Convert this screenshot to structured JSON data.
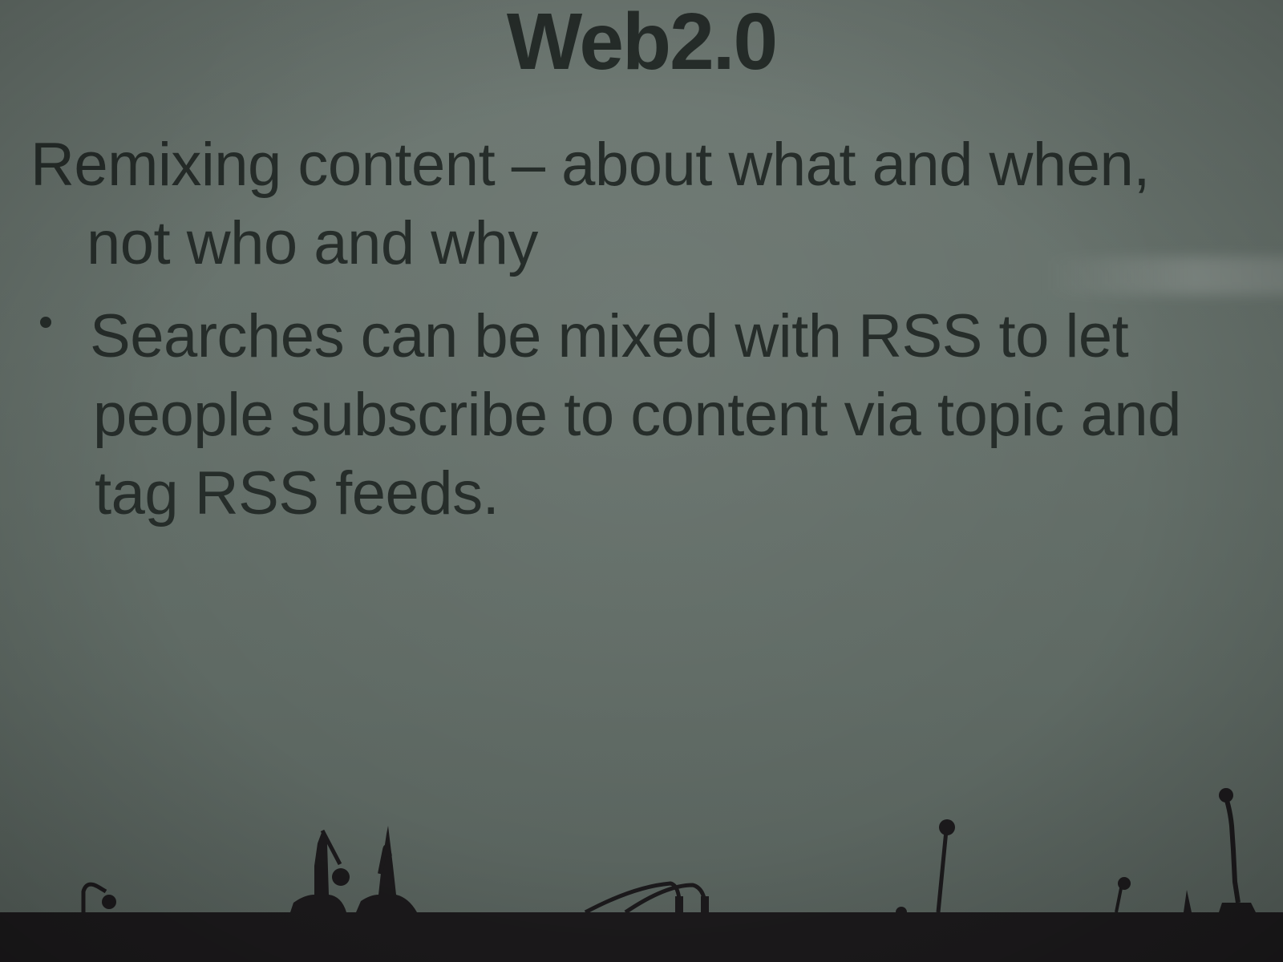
{
  "slide": {
    "title": "Web2.0",
    "para_line1": "Remixing content – about what and when,",
    "para_line2": "not who and why",
    "bullet_line1": "Searches can be mixed with RSS to let",
    "bullet_line2": "people subscribe to content via topic and",
    "bullet_line3": "tag RSS feeds."
  },
  "colors": {
    "screen": "#66716b",
    "text": "#262d2a",
    "silhouette": "#1c1a1c"
  }
}
